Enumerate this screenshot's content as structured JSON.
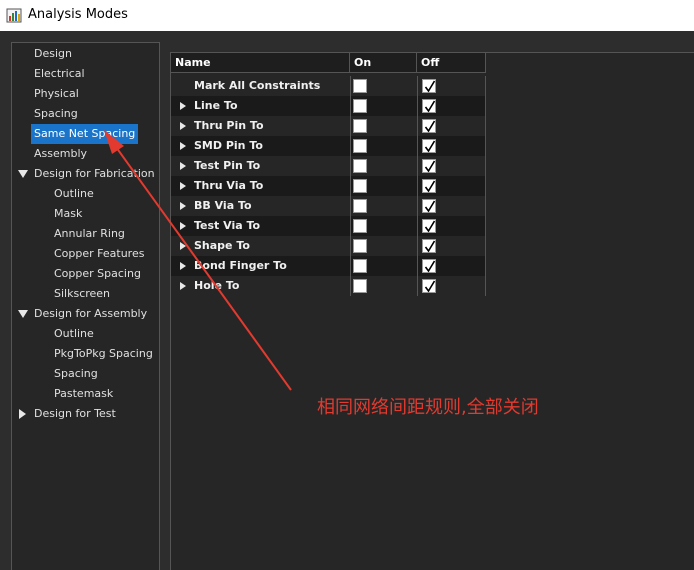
{
  "window": {
    "title": "Analysis Modes"
  },
  "tree": {
    "items": [
      {
        "label": "Design",
        "indent": 1
      },
      {
        "label": "Electrical",
        "indent": 1
      },
      {
        "label": "Physical",
        "indent": 1
      },
      {
        "label": "Spacing",
        "indent": 1
      },
      {
        "label": "Same Net Spacing",
        "indent": 1,
        "selected": true
      },
      {
        "label": "Assembly",
        "indent": 1
      },
      {
        "label": "Design for Fabrication",
        "indent": 1,
        "expanded": true
      },
      {
        "label": "Outline",
        "indent": 2
      },
      {
        "label": "Mask",
        "indent": 2
      },
      {
        "label": "Annular Ring",
        "indent": 2
      },
      {
        "label": "Copper Features",
        "indent": 2
      },
      {
        "label": "Copper Spacing",
        "indent": 2
      },
      {
        "label": "Silkscreen",
        "indent": 2
      },
      {
        "label": "Design for Assembly",
        "indent": 1,
        "expanded": true
      },
      {
        "label": "Outline",
        "indent": 2
      },
      {
        "label": "PkgToPkg Spacing",
        "indent": 2
      },
      {
        "label": "Spacing",
        "indent": 2
      },
      {
        "label": "Pastemask",
        "indent": 2
      },
      {
        "label": "Design for Test",
        "indent": 1,
        "expanded": false
      }
    ]
  },
  "grid": {
    "columns": {
      "name": "Name",
      "on": "On",
      "off": "Off"
    },
    "rows": [
      {
        "label": "Mark All Constraints",
        "expandable": false,
        "on": false,
        "off": true
      },
      {
        "label": "Line To",
        "expandable": true,
        "on": false,
        "off": true
      },
      {
        "label": "Thru Pin To",
        "expandable": true,
        "on": false,
        "off": true
      },
      {
        "label": "SMD Pin To",
        "expandable": true,
        "on": false,
        "off": true
      },
      {
        "label": "Test Pin To",
        "expandable": true,
        "on": false,
        "off": true
      },
      {
        "label": "Thru Via To",
        "expandable": true,
        "on": false,
        "off": true
      },
      {
        "label": "BB Via To",
        "expandable": true,
        "on": false,
        "off": true
      },
      {
        "label": "Test Via To",
        "expandable": true,
        "on": false,
        "off": true
      },
      {
        "label": "Shape To",
        "expandable": true,
        "on": false,
        "off": true
      },
      {
        "label": "Bond Finger To",
        "expandable": true,
        "on": false,
        "off": true
      },
      {
        "label": "Hole To",
        "expandable": true,
        "on": false,
        "off": true
      }
    ]
  },
  "annotation": {
    "text": "相同网络间距规则,全部关闭",
    "color": "#e23a2f"
  },
  "colors": {
    "selection": "#1a74c9",
    "background": "#2d2d2d"
  }
}
